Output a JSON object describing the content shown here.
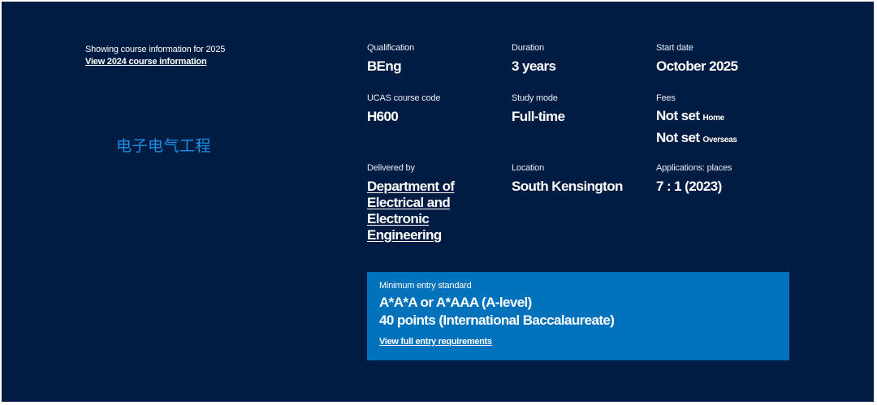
{
  "intro": {
    "showing_text": "Showing course information for 2025",
    "previous_year_link": "View 2024 course information"
  },
  "overlay_note": "电子电气工程",
  "details": {
    "qualification": {
      "label": "Qualification",
      "value": "BEng"
    },
    "duration": {
      "label": "Duration",
      "value": "3 years"
    },
    "start_date": {
      "label": "Start date",
      "value": "October 2025"
    },
    "ucas_code": {
      "label": "UCAS course code",
      "value": "H600"
    },
    "study_mode": {
      "label": "Study mode",
      "value": "Full-time"
    },
    "fees": {
      "label": "Fees",
      "home_value": "Not set",
      "home_suffix": "Home",
      "overseas_value": "Not set",
      "overseas_suffix": "Overseas"
    },
    "delivered_by": {
      "label": "Delivered by",
      "lines": [
        "Department of",
        "Electrical and",
        "Electronic",
        "Engineering"
      ]
    },
    "location": {
      "label": "Location",
      "value": "South Kensington"
    },
    "applications": {
      "label": "Applications: places",
      "value": "7 : 1 (2023)"
    }
  },
  "entry": {
    "label": "Minimum entry standard",
    "a_level": "A*A*A or A*AAA (A-level)",
    "ib": "40 points (International Baccalaureate)",
    "link": "View full entry requirements"
  },
  "colors": {
    "background": "#001c43",
    "entry_box": "#0072bb",
    "overlay_text": "#1a8fe6"
  }
}
